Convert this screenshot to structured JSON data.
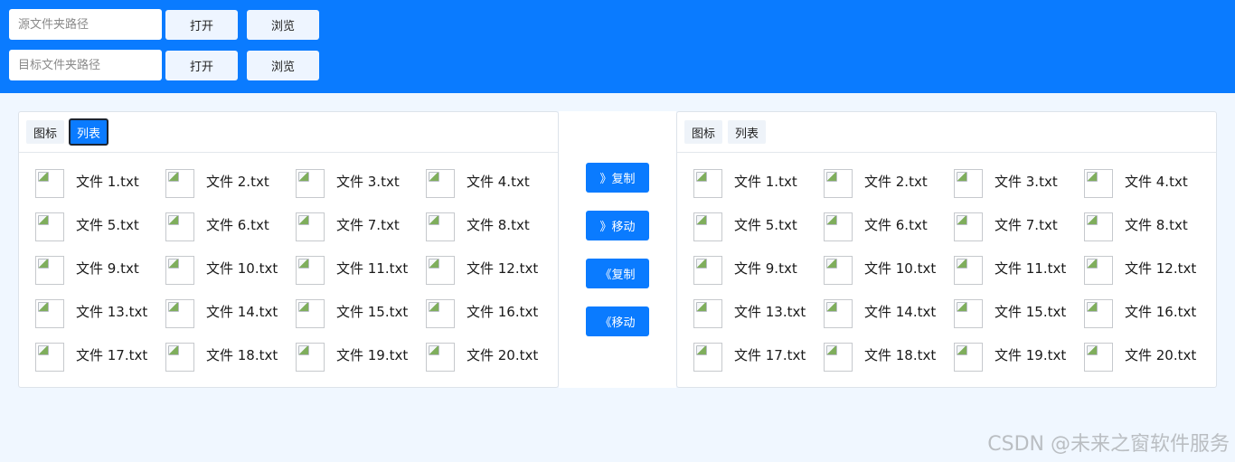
{
  "source": {
    "placeholder": "源文件夹路径",
    "open_label": "打开",
    "browse_label": "浏览"
  },
  "target": {
    "placeholder": "目标文件夹路径",
    "open_label": "打开",
    "browse_label": "浏览"
  },
  "left_panel": {
    "tabs": [
      {
        "label": "图标",
        "active": false
      },
      {
        "label": "列表",
        "active": true
      }
    ],
    "files": [
      "文件 1.txt",
      "文件 2.txt",
      "文件 3.txt",
      "文件 4.txt",
      "文件 5.txt",
      "文件 6.txt",
      "文件 7.txt",
      "文件 8.txt",
      "文件 9.txt",
      "文件 10.txt",
      "文件 11.txt",
      "文件 12.txt",
      "文件 13.txt",
      "文件 14.txt",
      "文件 15.txt",
      "文件 16.txt",
      "文件 17.txt",
      "文件 18.txt",
      "文件 19.txt",
      "文件 20.txt"
    ]
  },
  "right_panel": {
    "tabs": [
      {
        "label": "图标",
        "active": false
      },
      {
        "label": "列表",
        "active": false
      }
    ],
    "files": [
      "文件 1.txt",
      "文件 2.txt",
      "文件 3.txt",
      "文件 4.txt",
      "文件 5.txt",
      "文件 6.txt",
      "文件 7.txt",
      "文件 8.txt",
      "文件 9.txt",
      "文件 10.txt",
      "文件 11.txt",
      "文件 12.txt",
      "文件 13.txt",
      "文件 14.txt",
      "文件 15.txt",
      "文件 16.txt",
      "文件 17.txt",
      "文件 18.txt",
      "文件 19.txt",
      "文件 20.txt"
    ]
  },
  "actions": {
    "copy_right": "》复制",
    "move_right": "》移动",
    "copy_left": "《复制",
    "move_left": "《移动"
  },
  "watermark": "CSDN @未来之窗软件服务",
  "colors": {
    "accent": "#0a7bff",
    "page_bg": "#f0f7ff",
    "panel_bg": "#ffffff"
  },
  "icons": {
    "file_thumbnail": "broken-image-icon"
  }
}
